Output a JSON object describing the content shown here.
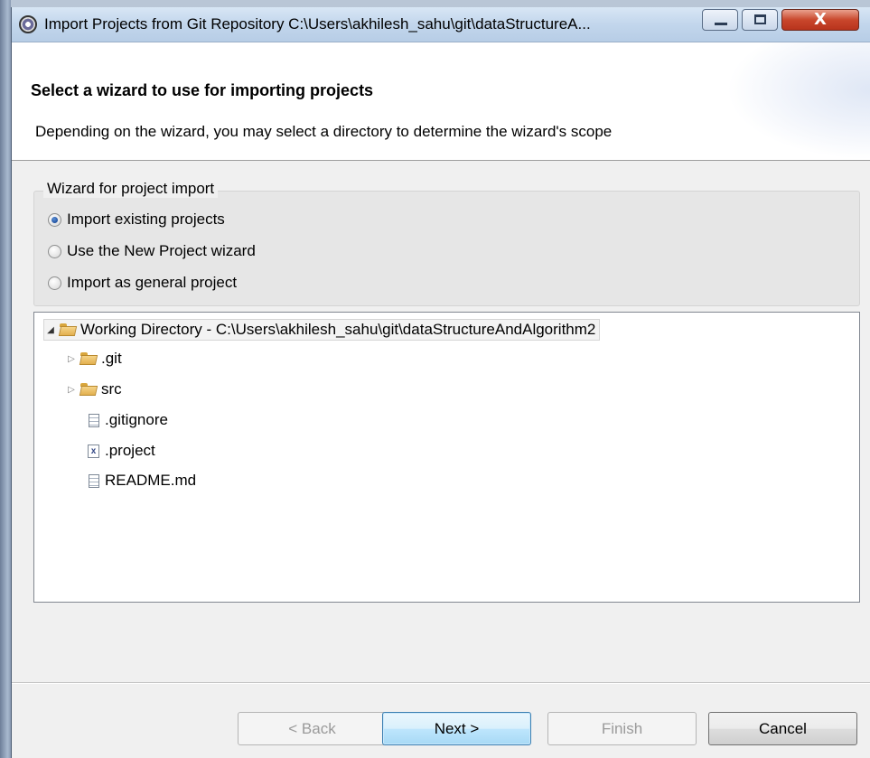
{
  "window": {
    "title": "Import Projects from Git Repository C:\\Users\\akhilesh_sahu\\git\\dataStructureA...",
    "close_glyph": "X"
  },
  "header": {
    "title": "Select a wizard to use for importing projects",
    "description": "Depending on the wizard, you may select a directory to determine the wizard's scope"
  },
  "wizard_group": {
    "label": "Wizard for project import",
    "options": [
      {
        "label": "Import existing projects",
        "checked": true
      },
      {
        "label": "Use the New Project wizard",
        "checked": false
      },
      {
        "label": "Import as general project",
        "checked": false
      }
    ]
  },
  "tree": {
    "root": {
      "label": "Working Directory - C:\\Users\\akhilesh_sahu\\git\\dataStructureAndAlgorithm2",
      "expanded": true,
      "icon": "folder-open-icon"
    },
    "children": [
      {
        "label": ".git",
        "type": "folder",
        "icon": "folder-open-icon"
      },
      {
        "label": "src",
        "type": "folder",
        "icon": "folder-open-icon"
      },
      {
        "label": ".gitignore",
        "type": "file",
        "icon": "text-file-icon"
      },
      {
        "label": ".project",
        "type": "xml",
        "icon": "xml-file-icon",
        "glyph": "x"
      },
      {
        "label": "README.md",
        "type": "file",
        "icon": "text-file-icon"
      }
    ]
  },
  "buttons": {
    "back": "< Back",
    "next": "Next >",
    "finish": "Finish",
    "cancel": "Cancel"
  }
}
